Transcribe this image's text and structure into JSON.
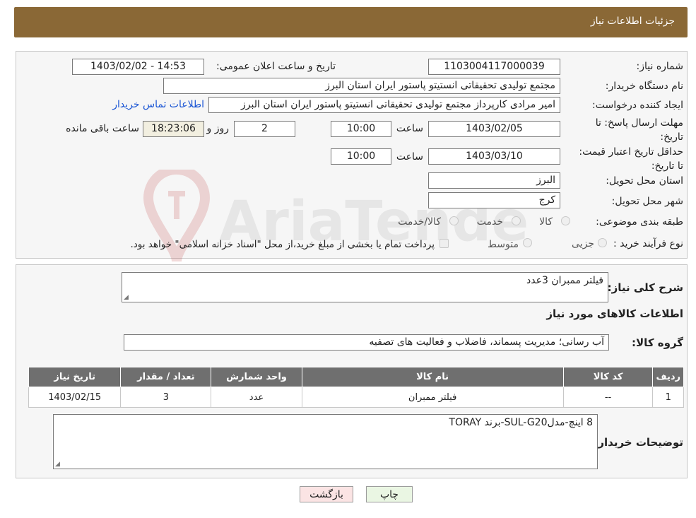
{
  "header": {
    "title": "جزئیات اطلاعات نیاز"
  },
  "form": {
    "need_number_label": "شماره نیاز:",
    "need_number": "1103004117000039",
    "announce_label": "تاریخ و ساعت اعلان عمومی:",
    "announce_value": "1403/02/02 - 14:53",
    "buyer_label": "نام دستگاه خریدار:",
    "buyer_value": "مجتمع تولیدی تحقیقاتی انستیتو پاستور ایران استان البرز",
    "creator_label": "ایجاد کننده درخواست:",
    "creator_value": "امیر مرادی کارپرداز مجتمع تولیدی تحقیقاتی انستیتو پاستور ایران استان البرز",
    "contact_link": "اطلاعات تماس خریدار",
    "deadline_label": "مهلت ارسال پاسخ: تا تاریخ:",
    "deadline_date": "1403/02/05",
    "time_label": "ساعت",
    "deadline_time": "10:00",
    "days_value": "2",
    "days_label": "روز و",
    "remaining_time": "18:23:06",
    "remaining_label": "ساعت باقی مانده",
    "validity_label": "حداقل تاریخ اعتبار قیمت: تا تاریخ:",
    "validity_date": "1403/03/10",
    "validity_time": "10:00",
    "province_label": "استان محل تحویل:",
    "province_value": "البرز",
    "city_label": "شهر محل تحویل:",
    "city_value": "کرج",
    "category_label": "طبقه بندی موضوعی:",
    "category_options": [
      "کالا",
      "خدمت",
      "کالا/خدمت"
    ],
    "purchase_label": "نوع فرآیند خرید :",
    "purchase_options": [
      "جزیی",
      "متوسط"
    ],
    "purchase_note": "پرداخت تمام یا بخشی از مبلغ خرید،از محل \"اسناد خزانه اسلامی\" خواهد بود."
  },
  "details": {
    "summary_label": "شرح کلی نیاز:",
    "summary_value": "فیلتر ممبران  3عدد",
    "goods_info_title": "اطلاعات کالاهای مورد نیاز",
    "group_label": "گروه کالا:",
    "group_value": "آب رسانی؛ مدیریت پسماند، فاضلاب و فعالیت های تصفیه",
    "table": {
      "headers": [
        "ردیف",
        "کد کالا",
        "نام کالا",
        "واحد شمارش",
        "تعداد / مقدار",
        "تاریخ نیاز"
      ],
      "rows": [
        [
          "1",
          "--",
          "فیلتر ممبران",
          "عدد",
          "3",
          "1403/02/15"
        ]
      ]
    },
    "buyer_notes_label": "توضیحات خریدار:",
    "buyer_notes_value": "8 اینچ-مدلSUL-G20-برند TORAY"
  },
  "buttons": {
    "print": "چاپ",
    "back": "بازگشت"
  },
  "watermark": {
    "text": "AriaTender.neT"
  },
  "colors": {
    "header": "#8a6836",
    "link": "#1a55d4",
    "table_header": "#6f6f6f"
  }
}
